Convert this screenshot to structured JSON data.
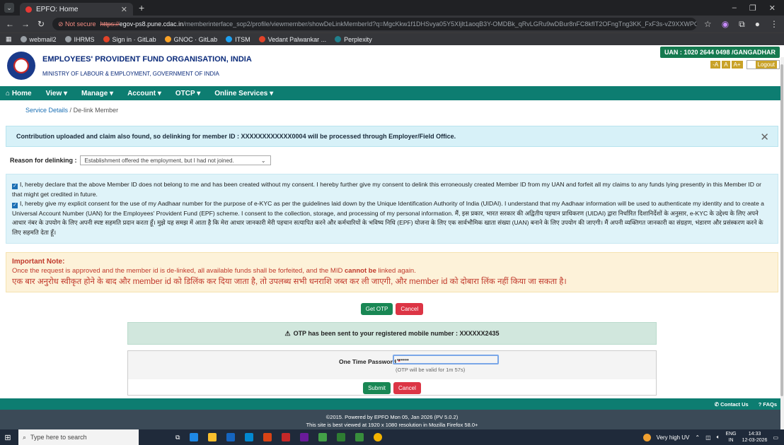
{
  "browser": {
    "tab_title": "EPFO: Home",
    "not_secure": "Not secure",
    "url_https": "https://",
    "url_host": "egov-ps8.pune.cdac.in",
    "url_path": "/memberinterface_sop2/profile/viewmember/showDeLinkMemberId?q=MgcKkw1f1DHSvya05Y5XIjlt1aoqB3Y-OMDBk_qRvLGRu9wDBur8nFC8kfIT2OFngTng3KK_FxF3s-vZ9XXWPOwWZO_UmeX-vpDC2bjycHd...",
    "bookmarks": [
      "webmail2",
      "IHRMS",
      "Sign in · GitLab",
      "GNOC · GitLab",
      "ITSM",
      "Vedant Palwankar ...",
      "Perplexity"
    ],
    "bookmark_colors": [
      "#5f6368",
      "#5f6368",
      "#e24329",
      "#fca326",
      "#1da1f2",
      "#e24329",
      "#20808d"
    ]
  },
  "header": {
    "org_name": "EMPLOYEES' PROVIDENT FUND ORGANISATION, INDIA",
    "ministry": "MINISTRY OF LABOUR & EMPLOYMENT, GOVERNMENT OF INDIA",
    "uan": "UAN : 1020 2644 0498 /GANGADHAR",
    "font_sizes": [
      "-A",
      "A",
      "A+"
    ],
    "logout": "Logout"
  },
  "nav": {
    "items": [
      "Home",
      "View ▾",
      "Manage ▾",
      "Account ▾",
      "OTCP ▾",
      "Online Services ▾"
    ]
  },
  "breadcrumb": {
    "link": "Service Details",
    "sep": "/",
    "current": "De-link Member"
  },
  "info_alert": "Contribution uploaded and claim also found, so delinking for member ID : XXXXXXXXXXXX0004 will be processed through Employer/Field Office.",
  "reason": {
    "label": "Reason for delinking :",
    "value": "Establishment offered the employment, but I had not joined."
  },
  "consent": {
    "c1": "I, hereby declare that the above Member ID does not belong to me and has been created without my consent. I hereby further give my consent to delink this erroneously created Member ID from my UAN and forfeit all my claims to any funds lying presently in this Member ID or that might get credited in future.",
    "c2": "I, hereby give my explicit consent for the use of my Aadhaar number for the purpose of e-KYC as per the guidelines laid down by the Unique Identification Authority of India (UIDAI). I understand that my Aadhaar information will be used to authenticate my identity and to create a Universal Account Number (UAN) for the Employees' Provident Fund (EPF) scheme. I consent to the collection, storage, and processing of my personal information.  मैं, इस प्रकार, भारत सरकार की अद्वितीय पहचान प्राधिकरण (UIDAI) द्वारा निर्धारित दिशानिर्देशों के अनुसार, e-KYC के उद्देश्य के लिए अपने आधार नंबर के उपयोग के लिए अपनी स्पष्ट सहमति प्रदान करता हूँ। मुझे यह समझ में आता है कि मेरा आधार जानकारी मेरी पहचान सत्यापित करने और कर्मचारियों के भविष्य निधि (EPF) योजना के लिए एक सार्वभौमिक खाता संख्या (UAN) बनाने के लिए उपयोग की जाएगी। मैं अपनी व्यक्तिगत जानकारी का संग्रहण, भंडारण और प्रसंस्करण करने के लिए सहमति देता हूँ।"
  },
  "important": {
    "title": "Important Note:",
    "en_before": "Once the request is approved and the member id is de-linked, all available funds shall be forfeited, and the MID ",
    "en_bold": "cannot be",
    "en_after": " linked again.",
    "hi": "एक बार अनुरोध स्वीकृत होने के बाद और member id को डिलिंक कर दिया जाता है, तो उपलब्ध सभी धनराशि जब्त कर ली जाएगी, और member id को दोबारा लिंक नहीं किया जा सकता है।"
  },
  "buttons": {
    "get_otp": "Get OTP",
    "cancel": "Cancel",
    "submit": "Submit",
    "cancel2": "Cancel"
  },
  "otp": {
    "sent_msg": "OTP has been sent to your registered mobile number : XXXXXX2435",
    "label": "One Time Password",
    "required": "*",
    "value": "••••••",
    "validity": "(OTP will be valid for 1m 57s)"
  },
  "footer": {
    "contact": "Contact Us",
    "faqs": "FAQs",
    "line1": "©2015. Powered by EPFO Mon 05, Jan 2026 (PV 5.0.2)",
    "line2": "This site is best viewed at 1920 x 1080 resolution in Mozilla Firefox 58.0+"
  },
  "taskbar": {
    "search_placeholder": "Type here to search",
    "weather": "Very high UV",
    "lang": "ENG",
    "region": "IN",
    "time": "14:33",
    "date": "12-03-2026"
  },
  "colors": {
    "nav_teal": "#0d7d71",
    "uan_green": "#157a4f",
    "danger": "#dc3545",
    "success": "#198754",
    "org_blue": "#0a2a7a"
  }
}
